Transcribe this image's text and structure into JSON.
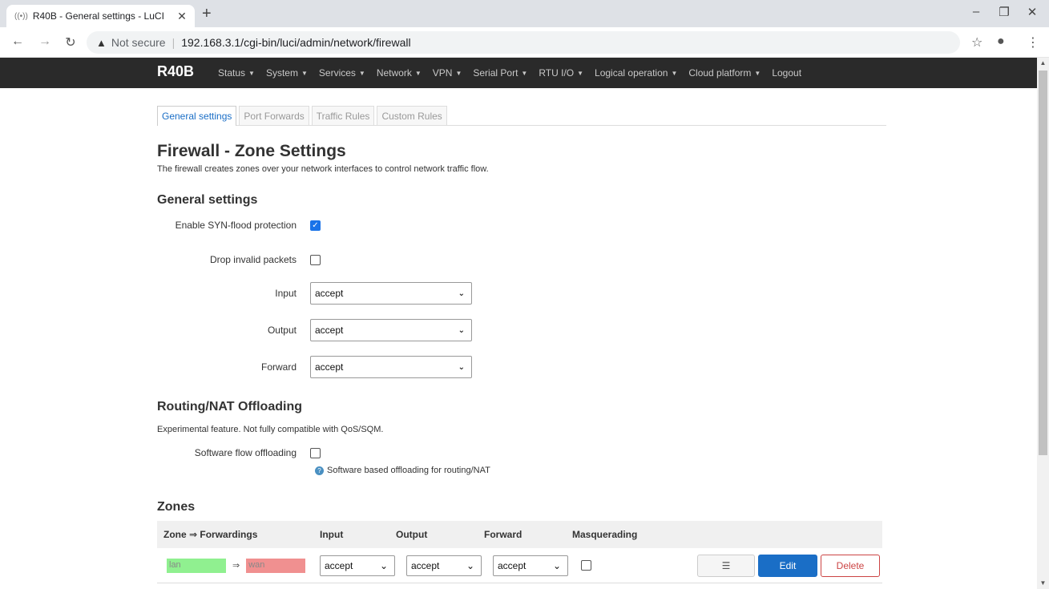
{
  "browser": {
    "tab_title": "R40B - General settings - LuCI",
    "tab_favicon": "((•))",
    "new_tab": "+",
    "not_secure": "Not secure",
    "url": "192.168.3.1/cgi-bin/luci/admin/network/firewall"
  },
  "navbar": {
    "brand": "R40B",
    "menu": [
      {
        "label": "Status",
        "dropdown": true
      },
      {
        "label": "System",
        "dropdown": true
      },
      {
        "label": "Services",
        "dropdown": true
      },
      {
        "label": "Network",
        "dropdown": true
      },
      {
        "label": "VPN",
        "dropdown": true
      },
      {
        "label": "Serial Port",
        "dropdown": true
      },
      {
        "label": "RTU I/O",
        "dropdown": true
      },
      {
        "label": "Logical operation",
        "dropdown": true
      },
      {
        "label": "Cloud platform",
        "dropdown": true
      },
      {
        "label": "Logout",
        "dropdown": false
      }
    ]
  },
  "content_tabs": [
    "General settings",
    "Port Forwards",
    "Traffic Rules",
    "Custom Rules"
  ],
  "page": {
    "title": "Firewall - Zone Settings",
    "description": "The firewall creates zones over your network interfaces to control network traffic flow."
  },
  "general": {
    "heading": "General settings",
    "syn_label": "Enable SYN-flood protection",
    "syn_checked": true,
    "drop_label": "Drop invalid packets",
    "drop_checked": false,
    "input_label": "Input",
    "input_value": "accept",
    "output_label": "Output",
    "output_value": "accept",
    "forward_label": "Forward",
    "forward_value": "accept"
  },
  "offload": {
    "heading": "Routing/NAT Offloading",
    "description": "Experimental feature. Not fully compatible with QoS/SQM.",
    "sw_label": "Software flow offloading",
    "sw_checked": false,
    "sw_hint": "Software based offloading for routing/NAT"
  },
  "zones": {
    "heading": "Zones",
    "columns": [
      "Zone ⇒ Forwardings",
      "Input",
      "Output",
      "Forward",
      "Masquerading"
    ],
    "rows": [
      {
        "zone": "lan",
        "arrow": "⇒",
        "forward_to": "wan",
        "input": "accept",
        "output": "accept",
        "forward": "accept",
        "masquerading": false,
        "sort_label": "☰",
        "edit_label": "Edit",
        "delete_label": "Delete"
      }
    ]
  },
  "colors": {
    "navbar_bg": "#2a2a2a",
    "active_tab": "#1a6ec6",
    "lan_chip": "#90f090",
    "wan_chip": "#f09090",
    "edit_button": "#1a6ec6",
    "delete_border": "#cc4444"
  }
}
